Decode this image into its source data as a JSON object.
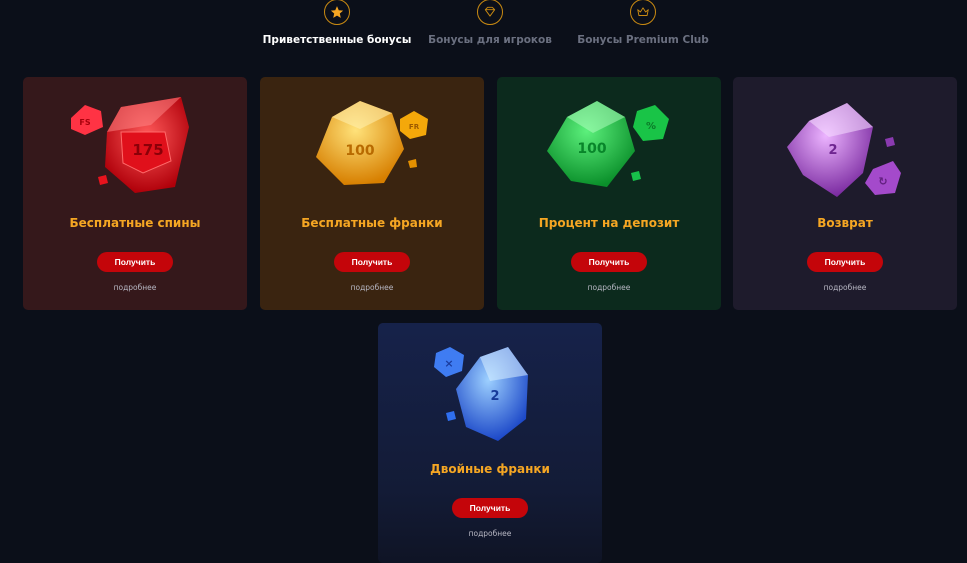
{
  "tabs": [
    {
      "label": "Приветственные бонусы",
      "icon": "star-icon",
      "active": true
    },
    {
      "label": "Бонусы для игроков",
      "icon": "diamond-icon",
      "active": false
    },
    {
      "label": "Бонусы Premium Club",
      "icon": "crown-icon",
      "active": false
    }
  ],
  "cards": [
    {
      "title": "Бесплатные спины",
      "button": "Получить",
      "more": "подробнее",
      "gem_value": "175",
      "gem_badge": "FS",
      "gem_icon": "red-gem-icon",
      "accent": "#e8131d"
    },
    {
      "title": "Бесплатные франки",
      "button": "Получить",
      "more": "подробнее",
      "gem_value": "100",
      "gem_badge": "FR",
      "gem_icon": "gold-gem-icon",
      "accent": "#f5a200"
    },
    {
      "title": "Процент на депозит",
      "button": "Получить",
      "more": "подробнее",
      "gem_value": "100",
      "gem_badge": "%",
      "gem_icon": "green-gem-icon",
      "accent": "#17c14a"
    },
    {
      "title": "Возврат",
      "button": "Получить",
      "more": "подробнее",
      "gem_value": "2",
      "gem_badge": "↻",
      "gem_icon": "purple-gem-icon",
      "accent": "#a24bc9"
    },
    {
      "title": "Двойные франки",
      "button": "Получить",
      "more": "подробнее",
      "gem_value": "2",
      "gem_badge": "×",
      "gem_icon": "blue-gem-icon",
      "accent": "#2f6ff0"
    }
  ],
  "colors": {
    "background": "#0b0f19",
    "title_text": "#f5a623",
    "button": "#c4050a",
    "tab_icon_ring": "#c98a12"
  }
}
